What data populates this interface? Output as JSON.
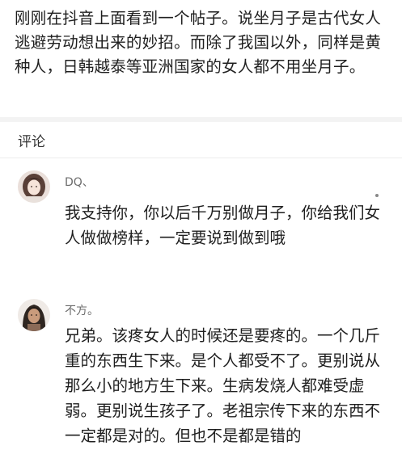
{
  "post": {
    "text": "刚刚在抖音上面看到一个帖子。说坐月子是古代女人逃避劳动想出来的妙招。而除了我国以外，同样是黄种人，日韩越泰等亚洲国家的女人都不用坐月子。"
  },
  "comments_section": {
    "title": "评论"
  },
  "comments": [
    {
      "username": "DQ、",
      "text": "我支持你，你以后千万别做月子，你给我们女人做做榜样，一定要说到做到哦"
    },
    {
      "username": "不方。",
      "text": "兄弟。该疼女人的时候还是要疼的。一个几斤重的东西生下来。是个人都受不了。更别说从那么小的地方生下来。生病发烧人都难受虚弱。更别说生孩子了。老祖宗传下来的东西不一定都是对的。但也不是都是错的"
    }
  ],
  "icons": {
    "avatar_1": "avatar-girl-icon",
    "avatar_2": "avatar-dark-hair-icon"
  },
  "colors": {
    "text": "#1f1f1f",
    "username": "#6b6b6b",
    "divider": "#f3f3f3"
  }
}
